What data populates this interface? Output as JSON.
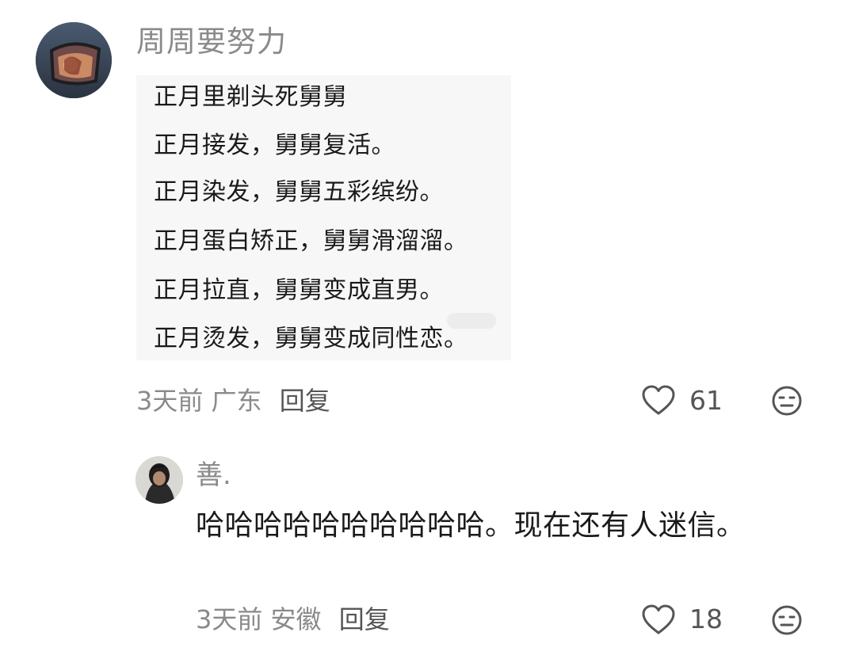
{
  "comment": {
    "username": "周周要努力",
    "avatar_icon": "avatar-icon",
    "image_lines": [
      "正月里剃头死舅舅",
      "正月接发，舅舅复活。",
      "正月染发，舅舅五彩缤纷。",
      "正月蛋白矫正，舅舅滑溜溜。",
      "正月拉直，舅舅变成直男。",
      "正月烫发，舅舅变成同性恋。"
    ],
    "time": "3天前",
    "location": "广东",
    "reply_label": "回复",
    "like_count": "61",
    "like_icon": "heart-outline-icon",
    "reaction_icon": "neutral-face-icon"
  },
  "reply": {
    "username": "善.",
    "avatar_icon": "avatar-icon",
    "text": "哈哈哈哈哈哈哈哈哈哈。现在还有人迷信。",
    "time": "3天前",
    "location": "安徽",
    "reply_label": "回复",
    "like_count": "18",
    "like_icon": "heart-outline-icon",
    "reaction_icon": "neutral-face-icon"
  },
  "colors": {
    "meta_text": "#8a8a8a",
    "body_text": "#1a1a1a",
    "icon_stroke": "#555555"
  }
}
